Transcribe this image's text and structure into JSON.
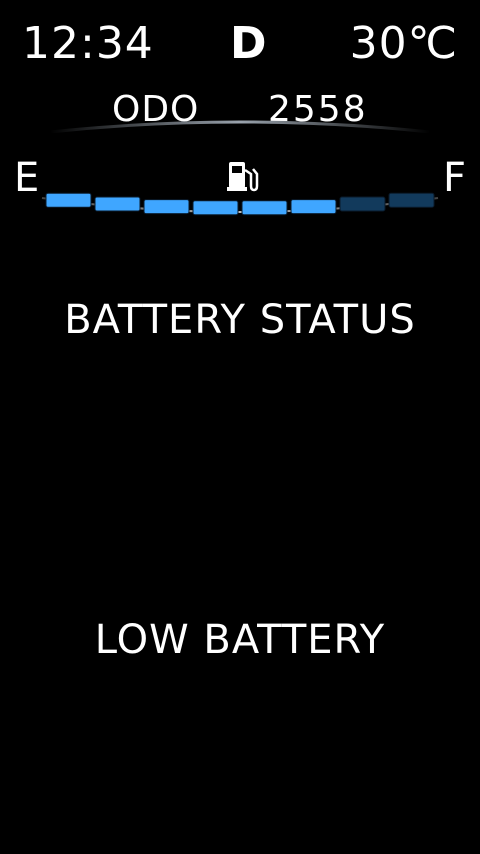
{
  "header": {
    "clock": "12:34",
    "gear": "D",
    "temperature": "30℃"
  },
  "odometer": {
    "label": "ODO",
    "value": "2558"
  },
  "fuel": {
    "empty_label": "E",
    "full_label": "F",
    "icon": "fuel-pump-icon",
    "segments_total": 8,
    "segments_lit": 6,
    "lit_color": "#3fa6ff",
    "unlit_color": "#123a5c"
  },
  "battery": {
    "title": "BATTERY STATUS",
    "message": "LOW BATTERY",
    "level_color": "#ff2a2a",
    "dial_color": "#c8102e"
  }
}
